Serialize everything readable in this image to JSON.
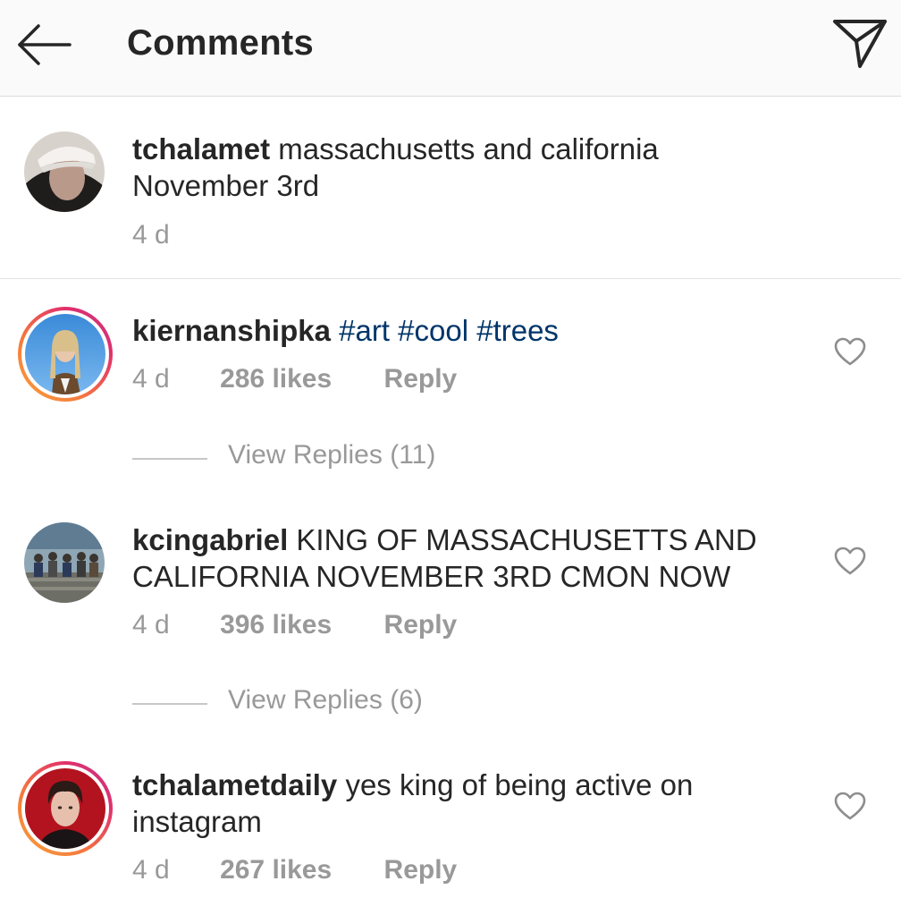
{
  "header": {
    "title": "Comments",
    "back_icon": "arrow-left-icon",
    "send_icon": "paper-plane-icon"
  },
  "caption": {
    "username": "tchalamet",
    "text": "massachusetts and california",
    "text_line2": "November 3rd",
    "time": "4 d"
  },
  "comments": [
    {
      "username": "kiernanshipka",
      "hashtags": [
        "#art",
        "#cool",
        "#trees"
      ],
      "time": "4 d",
      "likes": "286 likes",
      "reply_label": "Reply",
      "view_replies": "View Replies (11)",
      "has_story_ring": true
    },
    {
      "username": "kcingabriel",
      "text": "KING OF MASSACHUSETTS AND",
      "text_line2": "CALIFORNIA NOVEMBER 3RD CMON NOW",
      "time": "4 d",
      "likes": "396 likes",
      "reply_label": "Reply",
      "view_replies": "View Replies (6)",
      "has_story_ring": false
    },
    {
      "username": "tchalametdaily",
      "text": "yes king of being active on",
      "text_line2": "instagram",
      "time": "4 d",
      "likes": "267 likes",
      "reply_label": "Reply",
      "has_story_ring": true
    }
  ],
  "colors": {
    "hashtag": "#003569",
    "meta_gray": "#999999",
    "text": "#262626",
    "header_bg": "#fafafa"
  }
}
